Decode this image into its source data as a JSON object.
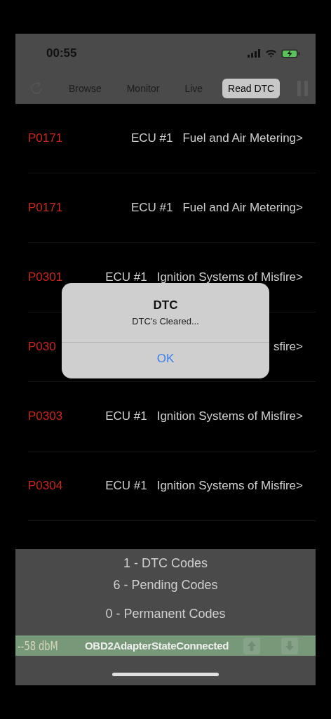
{
  "status_bar": {
    "time": "00:55"
  },
  "tabs": [
    {
      "label": "Browse",
      "selected": false
    },
    {
      "label": "Monitor",
      "selected": false
    },
    {
      "label": "Live",
      "selected": false
    },
    {
      "label": "Read DTC",
      "selected": true
    }
  ],
  "rows": [
    {
      "code": "P0171",
      "ecu": "ECU #1",
      "description": "Fuel and Air Metering>"
    },
    {
      "code": "P0171",
      "ecu": "ECU #1",
      "description": "Fuel and Air Metering>"
    },
    {
      "code": "P0301",
      "ecu": "ECU #1",
      "description": "Ignition Systems of Misfire>"
    },
    {
      "code": "P030",
      "description": "sfire>"
    },
    {
      "code": "P0303",
      "ecu": "ECU #1",
      "description": "Ignition Systems of Misfire>"
    },
    {
      "code": "P0304",
      "ecu": "ECU #1",
      "description": "Ignition Systems of Misfire>"
    }
  ],
  "summary": [
    "1 - DTC Codes",
    "6 - Pending Codes",
    "0 - Permanent Codes"
  ],
  "connection_bar": {
    "signal": "--58 dbM",
    "state": "OBD2AdapterStateConnected"
  },
  "alert": {
    "title": "DTC",
    "message": "DTC's Cleared...",
    "button": "OK"
  }
}
